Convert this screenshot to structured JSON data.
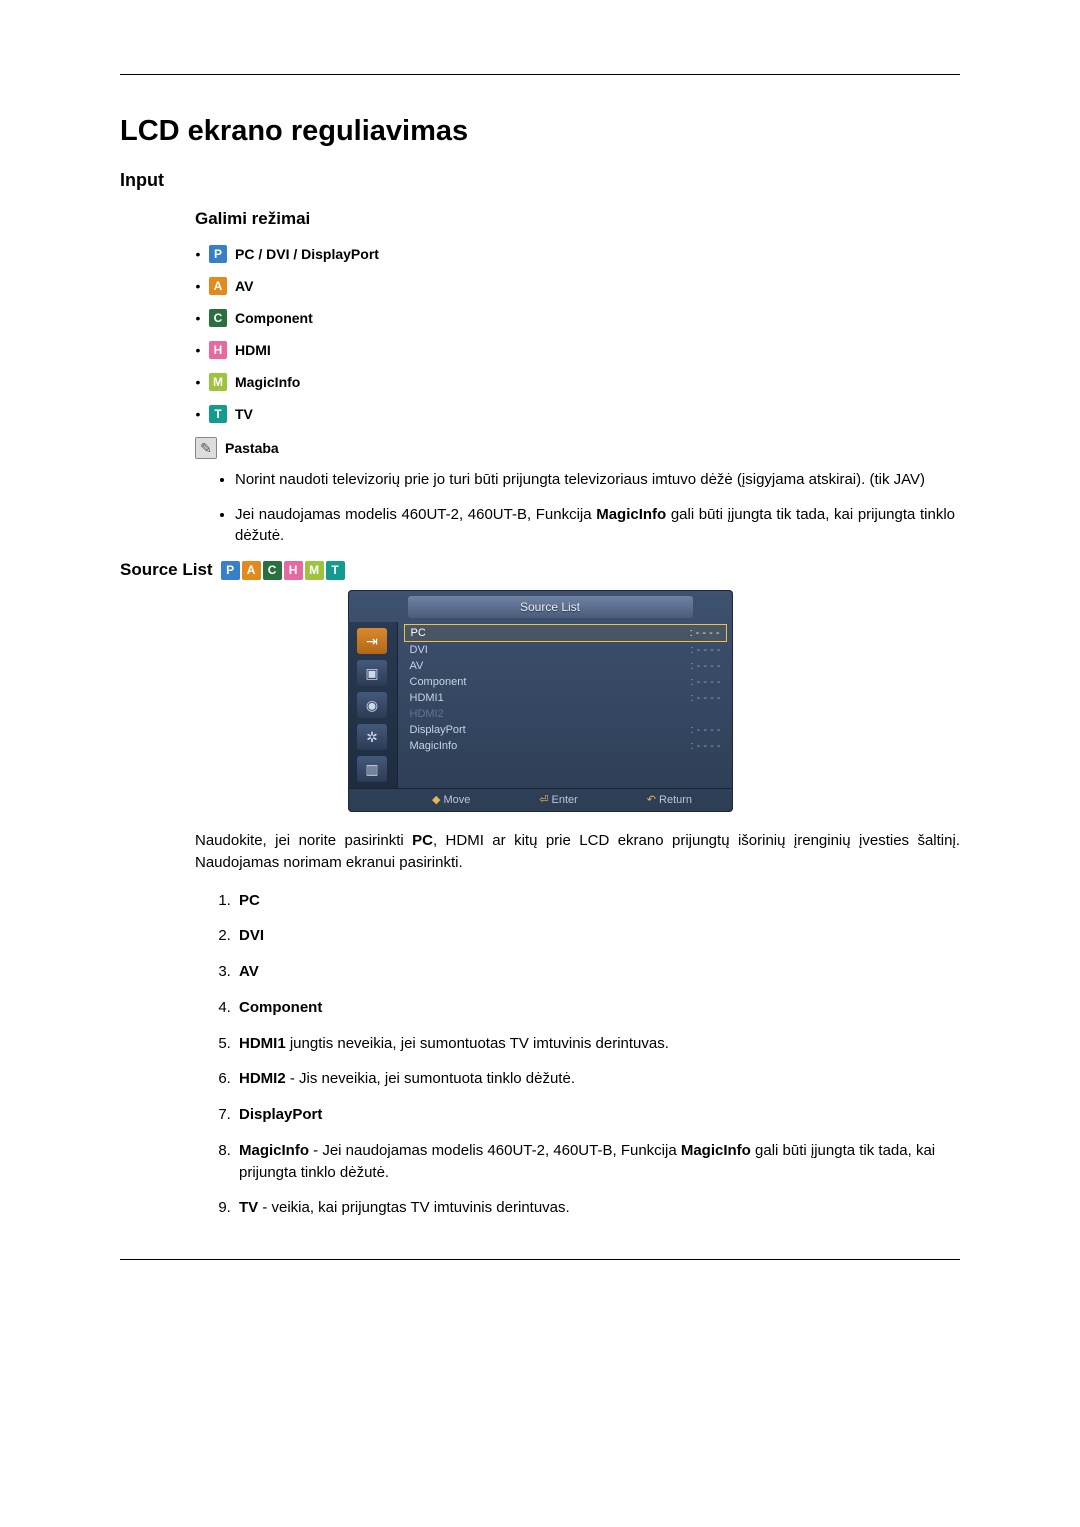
{
  "title": "LCD ekrano reguliavimas",
  "section_input": "Input",
  "sub_modes": "Galimi režimai",
  "modes": [
    {
      "icon": "P",
      "label": "PC / DVI / DisplayPort"
    },
    {
      "icon": "A",
      "label": "AV"
    },
    {
      "icon": "C",
      "label": "Component"
    },
    {
      "icon": "H",
      "label": "HDMI"
    },
    {
      "icon": "M",
      "label": "MagicInfo"
    },
    {
      "icon": "T",
      "label": "TV"
    }
  ],
  "note_label": "Pastaba",
  "notes": [
    "Norint naudoti televizorių prie jo turi būti prijungta televizoriaus imtuvo dėžė (įsigyjama atskirai). (tik JAV)",
    "Jei naudojamas modelis 460UT-2, 460UT-B, Funkcija MagicInfo gali būti įjungta tik tada, kai prijungta tinklo dėžutė."
  ],
  "note2_bold": "MagicInfo",
  "source_list_title": "Source List",
  "osd": {
    "header": "Source List",
    "rows": [
      {
        "name": "PC",
        "val": ": - - - -",
        "sel": true
      },
      {
        "name": "DVI",
        "val": ": - - - -"
      },
      {
        "name": "AV",
        "val": ": - - - -"
      },
      {
        "name": "Component",
        "val": ": - - - -"
      },
      {
        "name": "HDMI1",
        "val": ": - - - -"
      },
      {
        "name": "HDMI2",
        "val": "",
        "dim": true
      },
      {
        "name": "DisplayPort",
        "val": ": - - - -"
      },
      {
        "name": "MagicInfo",
        "val": ": - - - -"
      }
    ],
    "foot": {
      "move": "Move",
      "enter": "Enter",
      "ret": "Return"
    }
  },
  "para_pre": "Naudokite, jei norite pasirinkti ",
  "para_bold": "PC",
  "para_post": ", HDMI ar kitų prie LCD ekrano prijungtų išorinių įrenginių įvesties šaltinį. Naudojamas norimam ekranui pasirinkti.",
  "numbered": [
    {
      "bold": "PC",
      "rest": ""
    },
    {
      "bold": "DVI",
      "rest": ""
    },
    {
      "bold": "AV",
      "rest": ""
    },
    {
      "bold": "Component",
      "rest": ""
    },
    {
      "bold": "HDMI1",
      "rest": " jungtis neveikia, jei sumontuotas TV imtuvinis derintuvas."
    },
    {
      "bold": "HDMI2",
      "rest": " - Jis neveikia, jei sumontuota tinklo dėžutė."
    },
    {
      "bold": "DisplayPort",
      "rest": ""
    },
    {
      "bold": "MagicInfo",
      "rest": " - Jei naudojamas modelis 460UT-2, 460UT-B, Funkcija MagicInfo gali būti įjungta tik tada, kai prijungta tinklo dėžutė.",
      "inner_bold": "MagicInfo"
    },
    {
      "bold": "TV",
      "rest": " - veikia, kai prijungtas TV imtuvinis derintuvas."
    }
  ]
}
